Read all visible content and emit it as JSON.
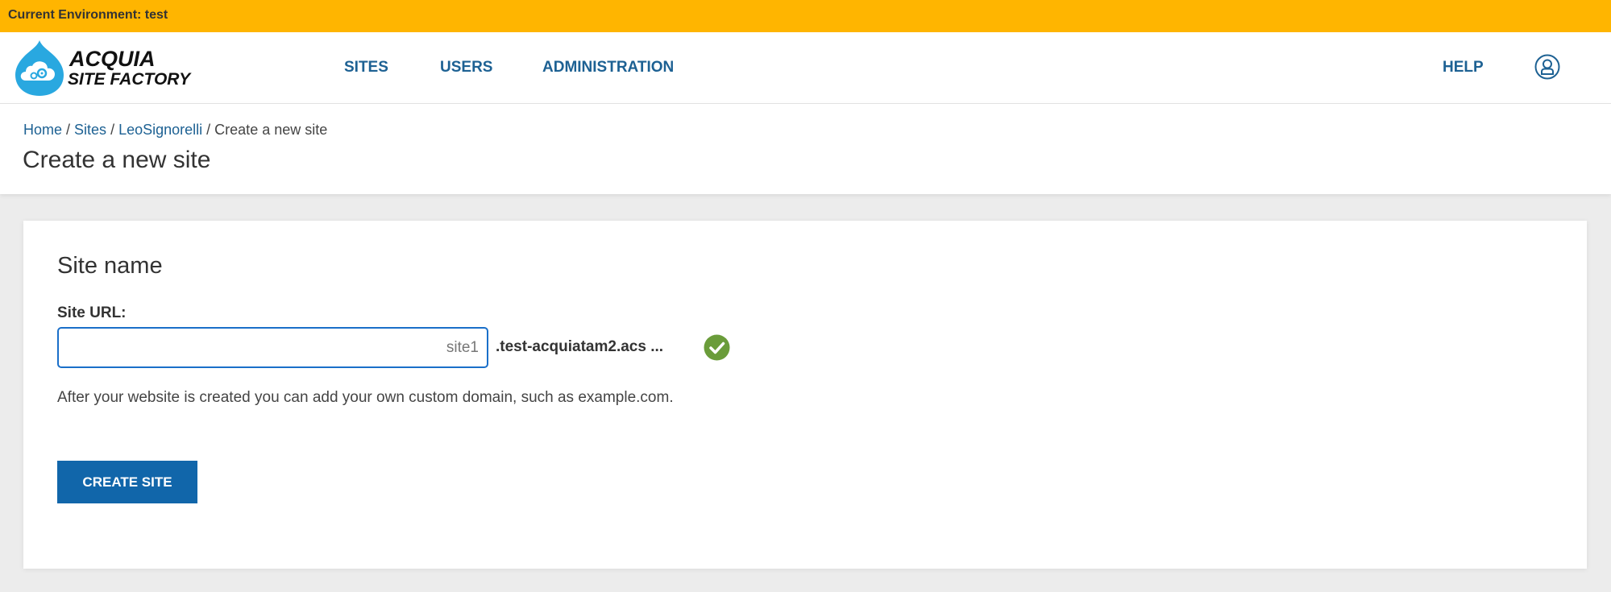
{
  "environment": {
    "label": "Current Environment: test",
    "color": "#ffb500"
  },
  "header": {
    "logo": {
      "line1": "ACQUIA",
      "line2": "SITE FACTORY",
      "icon": "cloud-gears-drop-icon",
      "color": "#29a8e0"
    },
    "nav": [
      {
        "label": "SITES"
      },
      {
        "label": "USERS"
      },
      {
        "label": "ADMINISTRATION"
      }
    ],
    "help_label": "HELP",
    "user_icon": "user-profile-icon",
    "accent_color": "#1d6193"
  },
  "breadcrumb": {
    "items": [
      {
        "label": "Home"
      },
      {
        "label": "Sites"
      },
      {
        "label": "LeoSignorelli"
      }
    ],
    "current": "Create a new site",
    "separator": " / "
  },
  "page_title": "Create a new site",
  "form": {
    "section_title": "Site name",
    "site_url_label": "Site URL:",
    "site_url_value": "",
    "site_url_placeholder": "site1",
    "domain_suffix": ".test-acquiatam2.acs ...",
    "validation_icon": "check-circle-icon",
    "validation_color": "#6a9c3a",
    "help_text": "After your website is created you can add your own custom domain, such as example.com.",
    "submit_label": "CREATE SITE",
    "submit_color": "#1166aa"
  }
}
